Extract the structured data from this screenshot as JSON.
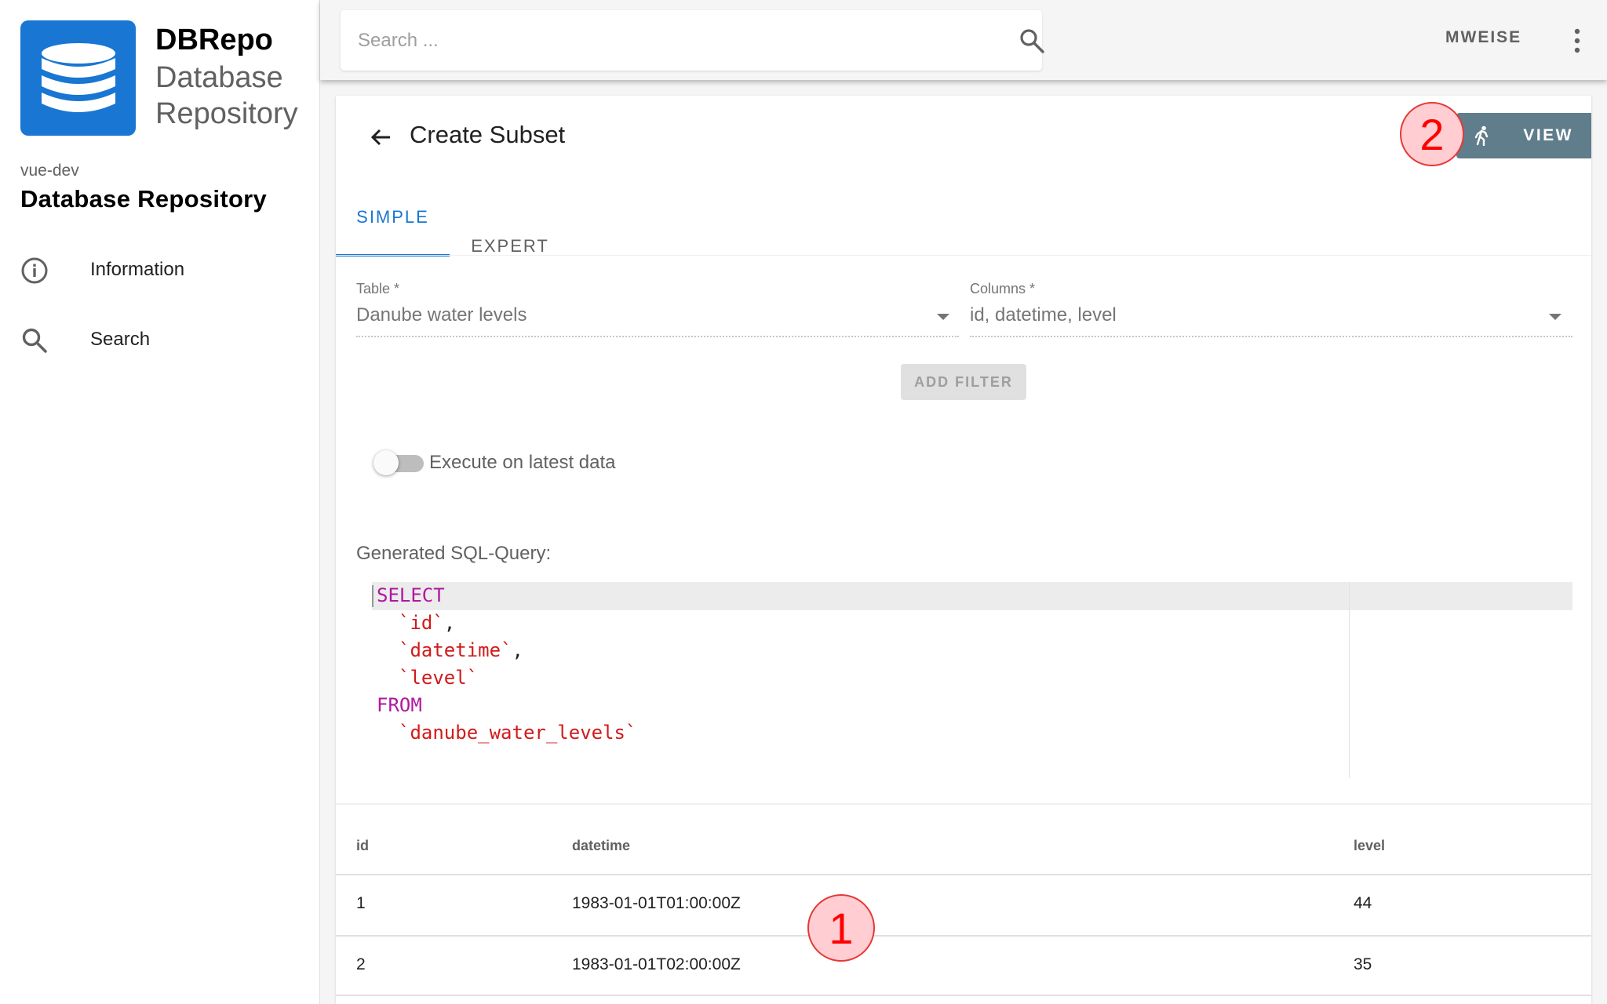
{
  "sidebar": {
    "brand_name": "DBRepo",
    "brand_subtitle": "Database Repository",
    "instance": "vue-dev",
    "repo_name": "Database Repository",
    "items": [
      {
        "label": "Information",
        "icon": "info-icon"
      },
      {
        "label": "Search",
        "icon": "search-icon"
      }
    ]
  },
  "topbar": {
    "search_placeholder": "Search ...",
    "user": "MWEISE"
  },
  "page": {
    "title": "Create Subset",
    "view_label": "VIEW",
    "tabs": [
      {
        "label": "SIMPLE",
        "active": true
      },
      {
        "label": "EXPERT",
        "active": false
      }
    ]
  },
  "form": {
    "table_label": "Table *",
    "table_value": "Danube water levels",
    "columns_label": "Columns *",
    "columns_value": "id, datetime, level",
    "add_filter_label": "ADD FILTER",
    "switch_label": "Execute on latest data",
    "switch_on": false
  },
  "sql": {
    "label": "Generated SQL-Query:",
    "lines": [
      {
        "kw": "SELECT"
      },
      {
        "str": "`id`",
        "punc": ","
      },
      {
        "str": "`datetime`",
        "punc": ","
      },
      {
        "str": "`level`"
      },
      {
        "kw": "FROM"
      },
      {
        "str": "`danube_water_levels`"
      }
    ]
  },
  "results": {
    "columns": [
      "id",
      "datetime",
      "level"
    ],
    "rows": [
      [
        "1",
        "1983-01-01T01:00:00Z",
        "44"
      ],
      [
        "2",
        "1983-01-01T02:00:00Z",
        "35"
      ]
    ]
  },
  "annotations": {
    "marker_1": "1",
    "marker_2": "2"
  },
  "colors": {
    "primary": "#1976d2",
    "view_button": "#607d8b",
    "annotation": "#ff0000",
    "sql_keyword": "#b0179f",
    "sql_string": "#d11a1a"
  }
}
